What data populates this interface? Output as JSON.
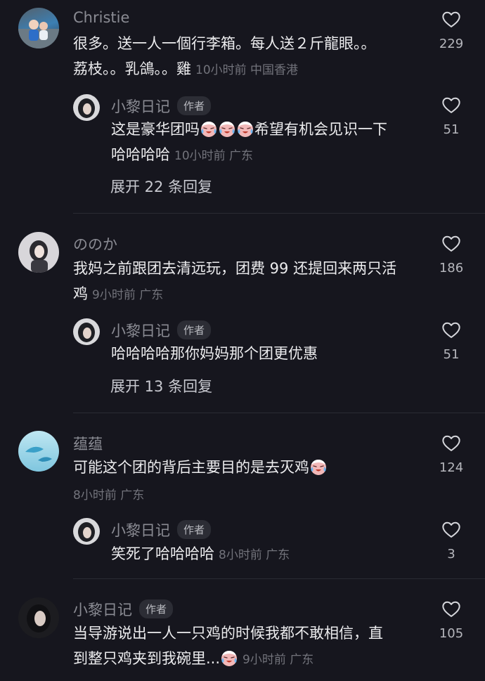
{
  "comments": [
    {
      "author": "Christie",
      "text_line1": "很多。送一人一個行李箱。每人送２斤龍眼。。",
      "text_line2": "荔枝。。乳鴿。。雞",
      "meta": "10小时前 中国香港",
      "likes": "229",
      "reply": {
        "author": "小黎日记",
        "badge": "作者",
        "text_line1a": "这是豪华团吗",
        "text_line1b": "希望有机会见识一下",
        "text_line2": "哈哈哈哈",
        "meta": "10小时前 广东",
        "likes": "51"
      },
      "expand": "展开 22 条回复"
    },
    {
      "author": "ののか",
      "text_line1": "我妈之前跟团去清远玩，团费 99 还提回来两只活",
      "text_line2": "鸡",
      "meta": "9小时前 广东",
      "likes": "186",
      "reply": {
        "author": "小黎日记",
        "badge": "作者",
        "text_line1": "哈哈哈哈那你妈妈那个团更优惠",
        "likes": "51"
      },
      "expand": "展开 13 条回复"
    },
    {
      "author": "蕴蕴",
      "text_line1": "可能这个团的背后主要目的是去灭鸡",
      "meta": "8小时前 广东",
      "likes": "124",
      "reply": {
        "author": "小黎日记",
        "badge": "作者",
        "text_line1": "笑死了哈哈哈哈",
        "meta": "8小时前 广东",
        "likes": "3"
      }
    },
    {
      "author": "小黎日记",
      "badge": "作者",
      "text_line1": "当导游说出一人一只鸡的时候我都不敢相信，直",
      "text_line2": "到整只鸡夹到我碗里...",
      "meta": "9小时前 广东",
      "likes": "105"
    }
  ],
  "colors": {
    "background": "#16161e",
    "text": "#ececee",
    "muted": "#8a8b93"
  },
  "icons": {
    "like": "heart-outline-icon",
    "emoji": "crying-laughing-emoji"
  }
}
